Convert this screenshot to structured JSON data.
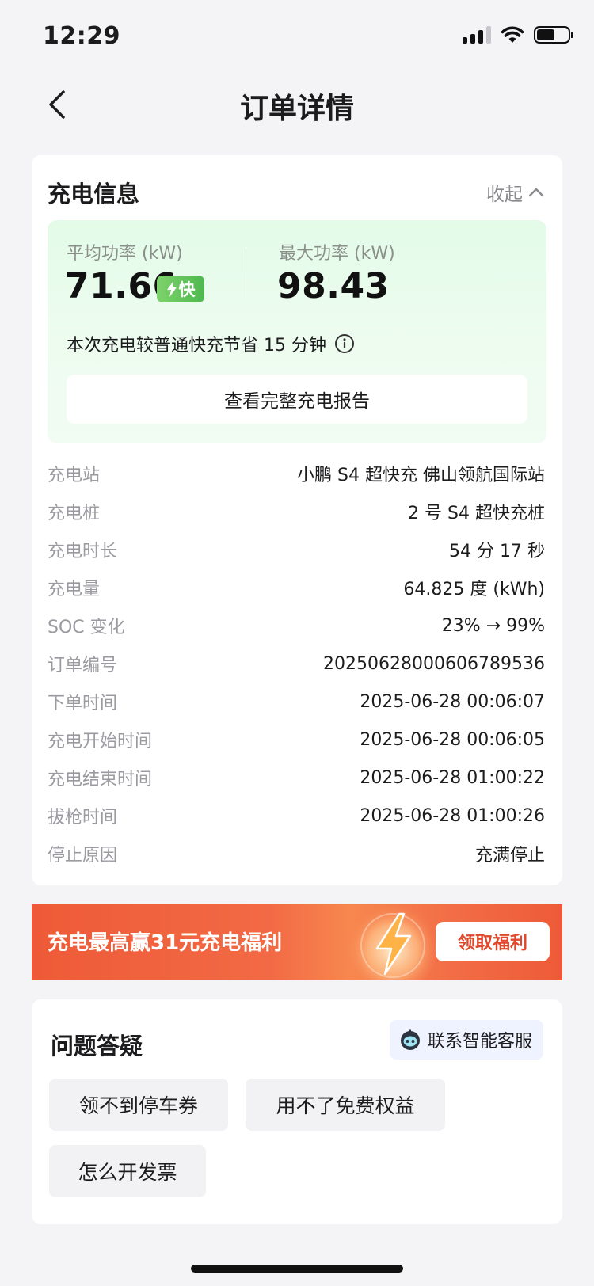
{
  "status_bar": {
    "time": "12:29"
  },
  "header": {
    "title": "订单详情"
  },
  "charging_info": {
    "title": "充电信息",
    "collapse_label": "收起",
    "avg_power_label": "平均功率 (kW)",
    "avg_power_value": "71.66",
    "fast_badge": "快",
    "max_power_label": "最大功率 (kW)",
    "max_power_value": "98.43",
    "savings_note": "本次充电较普通快充节省 15 分钟",
    "report_button": "查看完整充电报告",
    "details": [
      {
        "label": "充电站",
        "value": "小鹏 S4 超快充 佛山领航国际站"
      },
      {
        "label": "充电桩",
        "value": "2 号 S4 超快充桩"
      },
      {
        "label": "充电时长",
        "value": "54 分 17 秒"
      },
      {
        "label": "充电量",
        "value": "64.825 度 (kWh)"
      },
      {
        "label": "SOC 变化",
        "value": "23% → 99%"
      },
      {
        "label": "订单编号",
        "value": "20250628000606789536"
      },
      {
        "label": "下单时间",
        "value": "2025-06-28 00:06:07"
      },
      {
        "label": "充电开始时间",
        "value": "2025-06-28 00:06:05"
      },
      {
        "label": "充电结束时间",
        "value": "2025-06-28 01:00:22"
      },
      {
        "label": "拔枪时间",
        "value": "2025-06-28 01:00:26"
      },
      {
        "label": "停止原因",
        "value": "充满停止"
      }
    ]
  },
  "promo": {
    "text": "充电最高赢31元充电福利",
    "button": "领取福利"
  },
  "faq": {
    "title": "问题答疑",
    "support_button": "联系智能客服",
    "chips": [
      "领不到停车券",
      "用不了免费权益",
      "怎么开发票"
    ]
  },
  "colors": {
    "accent_green": "#4fb84f",
    "promo_orange": "#ee5a37",
    "promo_button_text": "#e0482b"
  },
  "icons": [
    "back-arrow-icon",
    "chevron-up-icon",
    "lightning-icon",
    "info-icon",
    "robot-icon",
    "signal-icon",
    "wifi-icon",
    "battery-icon"
  ]
}
